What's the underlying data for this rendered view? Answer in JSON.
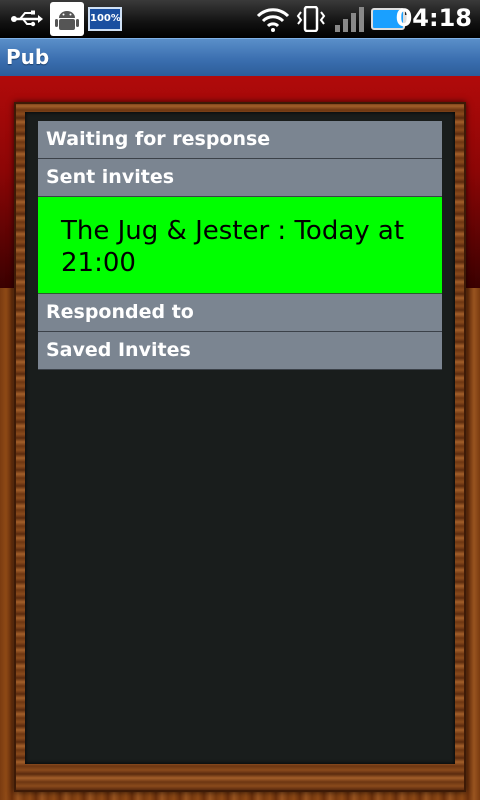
{
  "status_bar": {
    "time": "04:18",
    "battery_label": "100%",
    "icons": [
      "usb-icon",
      "android-debug-icon",
      "battery-notification-icon",
      "wifi-icon",
      "vibrate-icon",
      "signal-icon",
      "battery-icon"
    ]
  },
  "app": {
    "title": "Pub"
  },
  "sections": [
    {
      "label": "Waiting for response"
    },
    {
      "label": "Sent invites"
    },
    {
      "label": "Responded to"
    },
    {
      "label": "Saved Invites"
    }
  ],
  "sent_invites": [
    {
      "text": "The Jug & Jester : Today at 21:00",
      "highlight_color": "#00ff00"
    }
  ]
}
